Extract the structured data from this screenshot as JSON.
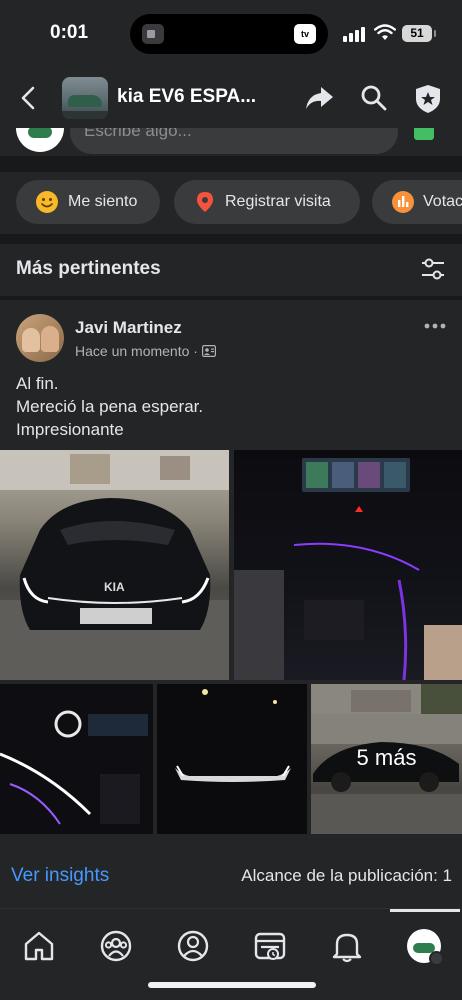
{
  "status_bar": {
    "time": "0:01",
    "island_icon": "tv",
    "battery": "51"
  },
  "header": {
    "title": "kia EV6 ESPA...",
    "icons": [
      "back-icon",
      "share-icon",
      "search-icon",
      "shield-star-icon"
    ]
  },
  "composer": {
    "placeholder": "Escribe algo..."
  },
  "chips": [
    {
      "label": "Me siento",
      "icon": "smile-icon",
      "color": "#f7b928"
    },
    {
      "label": "Registrar visita",
      "icon": "location-pin-icon",
      "color": "#f5533d"
    },
    {
      "label": "Votac",
      "icon": "poll-icon",
      "color": "#f7923a"
    }
  ],
  "section": {
    "title": "Más pertinentes"
  },
  "post": {
    "author": "Javi Martinez",
    "time": "Hace un momento",
    "text_lines": [
      "Al fin.",
      "Mereció la pena esperar.",
      "Impresionante"
    ],
    "more_photos_label": "5  más",
    "insights_link": "Ver insights",
    "reach_label": "Alcance de la publicación: 1"
  },
  "tabbar": {
    "items": [
      "home-icon",
      "groups-icon",
      "profile-icon",
      "feed-icon",
      "bell-icon",
      "menu-avatar-icon"
    ],
    "active_index": 5
  },
  "colors": {
    "background": "#242526",
    "divider": "#18191a",
    "link": "#4599ff",
    "text": "#e4e6eb"
  }
}
